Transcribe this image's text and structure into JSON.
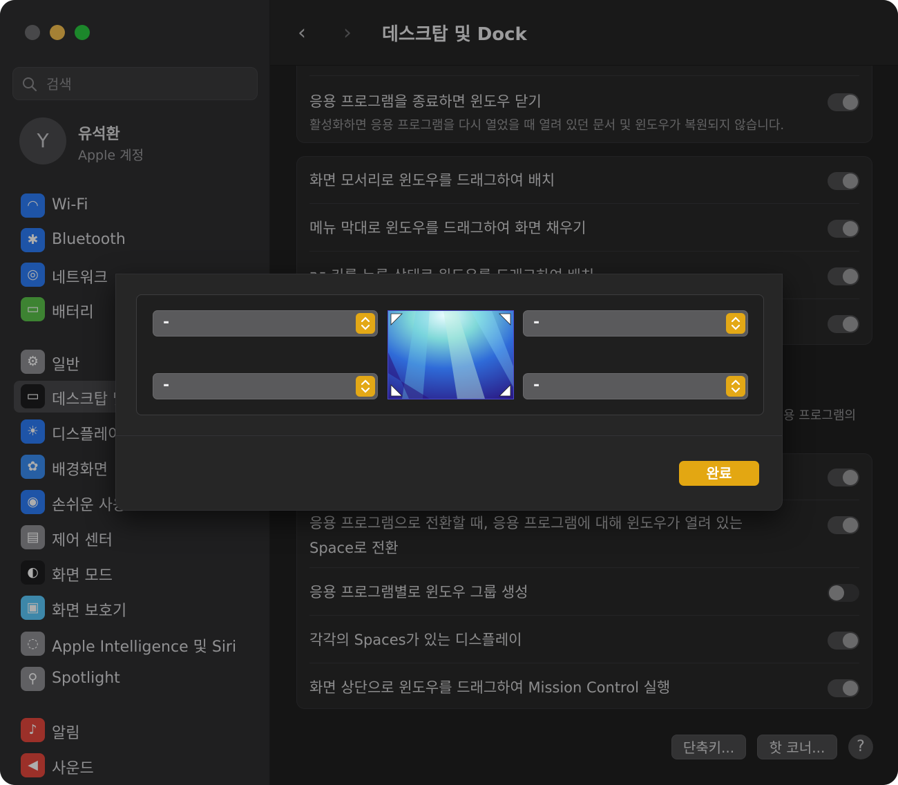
{
  "window": {
    "title": "데스크탑 및 Dock"
  },
  "sidebar": {
    "search_placeholder": "검색",
    "profile": {
      "initial": "Y",
      "name": "유석환",
      "subtitle": "Apple 계정"
    },
    "items": [
      {
        "label": "Wi-Fi",
        "icon": "wifi-icon",
        "color": "#2d7cf6"
      },
      {
        "label": "Bluetooth",
        "icon": "bluetooth-icon",
        "color": "#2d7cf6"
      },
      {
        "label": "네트워크",
        "icon": "globe-icon",
        "color": "#2d7cf6"
      },
      {
        "label": "배터리",
        "icon": "battery-icon",
        "color": "#5bc24b"
      },
      {
        "label": "일반",
        "icon": "gear-icon",
        "color": "#8e8e93"
      },
      {
        "label": "데스크탑 및 Dock",
        "icon": "dock-icon",
        "color": "#1c1c1e"
      },
      {
        "label": "디스플레이",
        "icon": "brightness-icon",
        "color": "#2d7cf6"
      },
      {
        "label": "배경화면",
        "icon": "flower-icon",
        "color": "#3a8df0"
      },
      {
        "label": "손쉬운 사용",
        "icon": "accessibility-icon",
        "color": "#2d7cf6"
      },
      {
        "label": "제어 센터",
        "icon": "control-center-icon",
        "color": "#8e8e93"
      },
      {
        "label": "화면 모드",
        "icon": "appearance-icon",
        "color": "#1c1c1e"
      },
      {
        "label": "화면 보호기",
        "icon": "screensaver-icon",
        "color": "#5ac8fa"
      },
      {
        "label": "Apple Intelligence 및 Siri",
        "icon": "siri-icon",
        "color": "#8e8e93"
      },
      {
        "label": "Spotlight",
        "icon": "spotlight-icon",
        "color": "#8e8e93"
      },
      {
        "label": "알림",
        "icon": "bell-icon",
        "color": "#e5483d"
      },
      {
        "label": "사운드",
        "icon": "speaker-icon",
        "color": "#e5483d"
      }
    ]
  },
  "main": {
    "card1": {
      "label": "응용 프로그램을 종료하면 윈도우 닫기",
      "sub": "활성화하면 응용 프로그램을 다시 열었을 때 열려 있던 문서 및 윈도우가 복원되지 않습니다."
    },
    "card2": [
      {
        "label": "화면 모서리로 윈도우를 드래그하여 배치"
      },
      {
        "label": "메뉴 막대로 윈도우를 드래그하여 화면 채우기"
      },
      {
        "label": "⌥ 키를 누른 상태로 윈도우를 드래그하여 배치"
      }
    ],
    "partial_text": "용 프로그램의",
    "card3": [
      {
        "label": "응용 프로그램으로 전환할 때, 응용 프로그램에 대해 윈도우가 열려 있는",
        "label2": "Space로 전환"
      },
      {
        "label": "응용 프로그램별로 윈도우 그룹 생성"
      },
      {
        "label": "각각의 Spaces가 있는 디스플레이"
      },
      {
        "label": "화면 상단으로 윈도우를 드래그하여 Mission Control 실행"
      }
    ],
    "buttons": {
      "shortcuts": "단축키...",
      "hot_corners": "핫 코너...",
      "help": "?"
    }
  },
  "sheet": {
    "top_left": "-",
    "top_right": "-",
    "bottom_left": "-",
    "bottom_right": "-",
    "done": "완료"
  },
  "colors": {
    "accent": "#e3a712"
  }
}
